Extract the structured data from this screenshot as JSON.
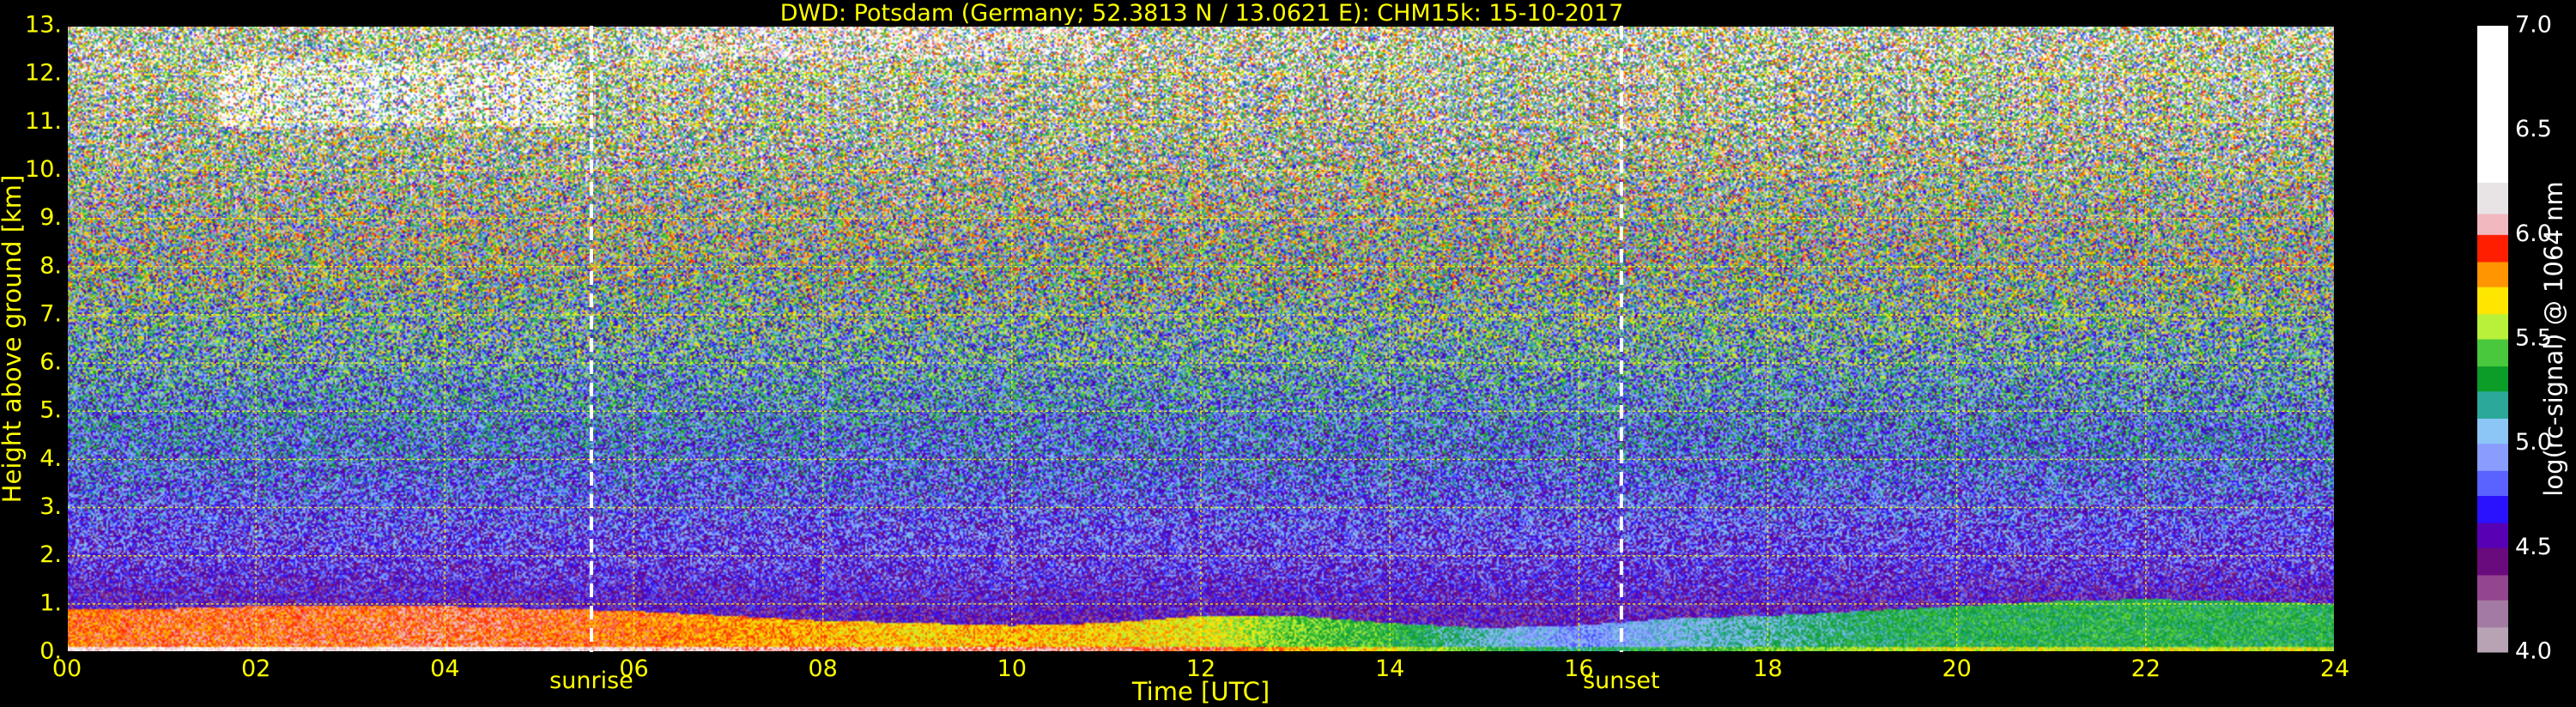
{
  "chart_data": {
    "type": "heatmap",
    "title": "DWD: Potsdam (Germany; 52.3813 N / 13.0621 E):    CHM15k: 15-10-2017",
    "xlabel": "Time [UTC]",
    "ylabel": "Height above ground [km]",
    "xlim": [
      0,
      24
    ],
    "ylim": [
      0,
      13
    ],
    "x_ticks": [
      "00",
      "02",
      "04",
      "06",
      "08",
      "10",
      "12",
      "14",
      "16",
      "18",
      "20",
      "22",
      "24"
    ],
    "y_ticks": [
      "0.",
      "1.",
      "2.",
      "3.",
      "4.",
      "5.",
      "6.",
      "7.",
      "8.",
      "9.",
      "10.",
      "11.",
      "12.",
      "13."
    ],
    "grid": true,
    "grid_color": "#ffff00",
    "colorbar": {
      "label": "log(rc-signal) @ 1064 nm",
      "range": [
        4.0,
        7.0
      ],
      "ticks": [
        "4.0",
        "4.5",
        "5.0",
        "5.5",
        "6.0",
        "6.5",
        "7.0"
      ],
      "colors": [
        {
          "v": 4.0,
          "c": "#b8a3b5"
        },
        {
          "v": 4.12,
          "c": "#a37ba2"
        },
        {
          "v": 4.25,
          "c": "#93468f"
        },
        {
          "v": 4.37,
          "c": "#6a0b7d"
        },
        {
          "v": 4.5,
          "c": "#5800b4"
        },
        {
          "v": 4.62,
          "c": "#2a12ff"
        },
        {
          "v": 4.75,
          "c": "#5a62ff"
        },
        {
          "v": 4.87,
          "c": "#8a9dff"
        },
        {
          "v": 5.0,
          "c": "#8cc6f6"
        },
        {
          "v": 5.12,
          "c": "#2ca89a"
        },
        {
          "v": 5.25,
          "c": "#0c9c28"
        },
        {
          "v": 5.37,
          "c": "#49c83d"
        },
        {
          "v": 5.5,
          "c": "#b8f03a"
        },
        {
          "v": 5.62,
          "c": "#ffe600"
        },
        {
          "v": 5.75,
          "c": "#ff9500"
        },
        {
          "v": 5.87,
          "c": "#ff1f00"
        },
        {
          "v": 6.0,
          "c": "#f2b8bf"
        },
        {
          "v": 6.1,
          "c": "#e8e3e4"
        },
        {
          "v": 6.25,
          "c": "#ffffff"
        },
        {
          "v": 7.0,
          "c": "#ffffff"
        }
      ]
    },
    "events": [
      {
        "label": "sunrise",
        "time": 5.55
      },
      {
        "label": "sunset",
        "time": 16.45
      }
    ],
    "boundary_layer": {
      "x": [
        0,
        1,
        2,
        3,
        4,
        5,
        6,
        7,
        8,
        9,
        10,
        11,
        12,
        13,
        14,
        15,
        16,
        17,
        18,
        19,
        20,
        21,
        22,
        23,
        24
      ],
      "top_km": [
        0.9,
        0.9,
        0.95,
        0.95,
        0.95,
        0.9,
        0.85,
        0.75,
        0.65,
        0.6,
        0.55,
        0.6,
        0.75,
        0.75,
        0.6,
        0.5,
        0.55,
        0.7,
        0.75,
        0.85,
        0.95,
        1.05,
        1.1,
        1.05,
        1.0
      ],
      "mean_log_signal": [
        5.8,
        5.85,
        5.85,
        5.85,
        5.9,
        5.85,
        5.8,
        5.75,
        5.7,
        5.65,
        5.7,
        5.65,
        5.6,
        5.4,
        5.3,
        5.05,
        4.85,
        5.0,
        5.1,
        5.2,
        5.25,
        5.25,
        5.25,
        5.25,
        5.25
      ]
    },
    "clouds": [
      {
        "t_start": 1.6,
        "t_end": 5.4,
        "h_bottom": 10.9,
        "h_top": 12.3,
        "log_signal": 6.5
      },
      {
        "t_start": 6.0,
        "t_end": 11.0,
        "h_bottom": 12.3,
        "h_top": 13.0,
        "log_signal": 6.2
      }
    ]
  }
}
